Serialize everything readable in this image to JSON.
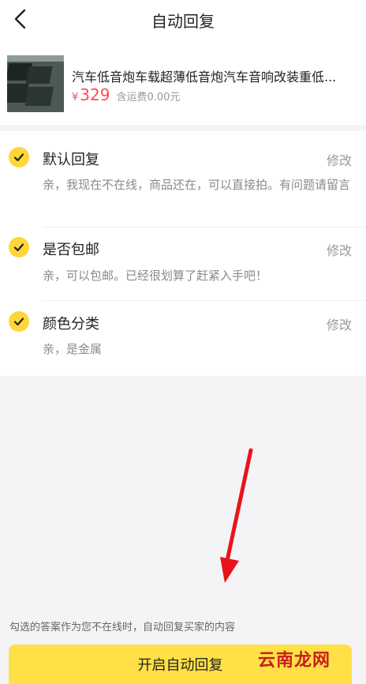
{
  "header": {
    "title": "自动回复",
    "back_icon": "chevron-left-icon"
  },
  "product": {
    "name": "汽车低音炮车载超薄低音炮汽车音响改装重低...",
    "currency": "¥",
    "price": "329",
    "shipping": "含运费0.00元"
  },
  "replies": [
    {
      "title": "默认回复",
      "edit": "修改",
      "content": "亲，我现在不在线，商品还在，可以直接拍。有问题请留言",
      "checked": true
    },
    {
      "title": "是否包邮",
      "edit": "修改",
      "content": "亲，可以包邮。已经很划算了赶紧入手吧！",
      "checked": true
    },
    {
      "title": "颜色分类",
      "edit": "修改",
      "content": "亲，是金属",
      "checked": true
    }
  ],
  "footer": {
    "note": "勾选的答案作为您不在线时，自动回复买家的内容",
    "button_label": "开启自动回复"
  },
  "watermark": "云南龙网",
  "colors": {
    "accent": "#ffd638",
    "price": "#ff4a5a",
    "annotation_arrow": "#e8141c"
  }
}
